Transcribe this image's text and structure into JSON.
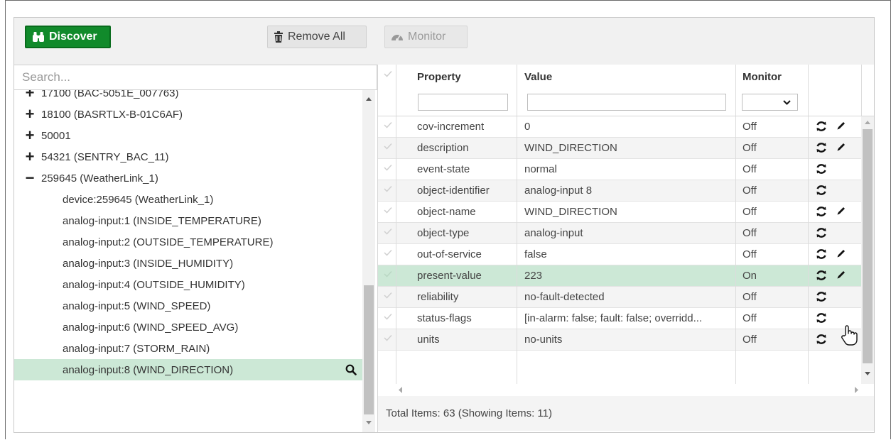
{
  "toolbar": {
    "discover_label": "Discover",
    "remove_all_label": "Remove All",
    "monitor_label": "Monitor"
  },
  "search": {
    "placeholder": "Search..."
  },
  "tree": {
    "devices": [
      {
        "label": "17100 (BAC-5051E_007763)",
        "expanded": false
      },
      {
        "label": "18100 (BASRTLX-B-01C6AF)",
        "expanded": false
      },
      {
        "label": "50001",
        "expanded": false
      },
      {
        "label": "54321 (SENTRY_BAC_11)",
        "expanded": false
      },
      {
        "label": "259645 (WeatherLink_1)",
        "expanded": true
      }
    ],
    "children": [
      "device:259645 (WeatherLink_1)",
      "analog-input:1 (INSIDE_TEMPERATURE)",
      "analog-input:2 (OUTSIDE_TEMPERATURE)",
      "analog-input:3 (INSIDE_HUMIDITY)",
      "analog-input:4 (OUTSIDE_HUMIDITY)",
      "analog-input:5 (WIND_SPEED)",
      "analog-input:6 (WIND_SPEED_AVG)",
      "analog-input:7 (STORM_RAIN)",
      "analog-input:8 (WIND_DIRECTION)"
    ],
    "selected": "analog-input:8 (WIND_DIRECTION)"
  },
  "grid": {
    "columns": {
      "property": "Property",
      "value": "Value",
      "monitor": "Monitor"
    },
    "rows": [
      {
        "property": "cov-increment",
        "value": "0",
        "monitor": "Off",
        "editable": true
      },
      {
        "property": "description",
        "value": "WIND_DIRECTION",
        "monitor": "Off",
        "editable": true
      },
      {
        "property": "event-state",
        "value": "normal",
        "monitor": "Off",
        "editable": false
      },
      {
        "property": "object-identifier",
        "value": "analog-input 8",
        "monitor": "Off",
        "editable": false
      },
      {
        "property": "object-name",
        "value": "WIND_DIRECTION",
        "monitor": "Off",
        "editable": true
      },
      {
        "property": "object-type",
        "value": "analog-input",
        "monitor": "Off",
        "editable": false
      },
      {
        "property": "out-of-service",
        "value": "false",
        "monitor": "Off",
        "editable": true
      },
      {
        "property": "present-value",
        "value": "223",
        "monitor": "On",
        "editable": true
      },
      {
        "property": "reliability",
        "value": "no-fault-detected",
        "monitor": "Off",
        "editable": false
      },
      {
        "property": "status-flags",
        "value": "[in-alarm: false; fault: false; overridd...",
        "monitor": "Off",
        "editable": false
      },
      {
        "property": "units",
        "value": "no-units",
        "monitor": "Off",
        "editable": false
      }
    ],
    "highlighted_property": "present-value",
    "footer": "Total Items: 63 (Showing Items: 11)"
  },
  "colors": {
    "discover_bg": "#118a2b",
    "selected_row": "#cce8d6",
    "toolbar_bg": "#f1f1f1"
  },
  "icons": {
    "discover": "binoculars-icon",
    "remove_all": "trash-icon",
    "monitor": "gauge-icon",
    "refresh": "sync-icon",
    "edit": "pencil-icon",
    "inspect": "search-icon"
  }
}
